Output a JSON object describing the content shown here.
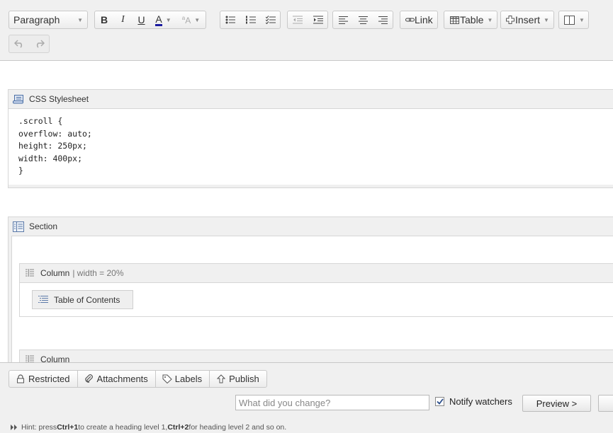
{
  "toolbar": {
    "format_select": "Paragraph",
    "link_label": "Link",
    "table_label": "Table",
    "insert_label": "Insert"
  },
  "content": {
    "stylesheet_macro": {
      "title": "CSS Stylesheet",
      "code": ".scroll {\noverflow: auto;\nheight: 250px;\nwidth: 400px;\n}"
    },
    "section_macro": {
      "title": "Section"
    },
    "column_1": {
      "title": "Column",
      "param": "| width = 20%"
    },
    "toc_macro": {
      "title": "Table of Contents"
    },
    "column_2": {
      "title": "Column"
    }
  },
  "footer": {
    "tabs": [
      "Restricted",
      "Attachments",
      "Labels",
      "Publish"
    ],
    "change_placeholder": "What did you change?",
    "notify_label": "Notify watchers",
    "notify_checked": true,
    "preview_label": "Preview >",
    "hint": {
      "prefix": "Hint: press ",
      "key1": "Ctrl+1",
      "mid": " to create a heading level 1, ",
      "key2": "Ctrl+2",
      "suffix": " for heading level 2 and so on."
    }
  }
}
